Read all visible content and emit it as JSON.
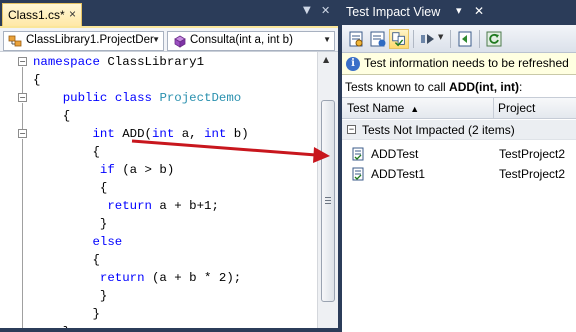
{
  "editor": {
    "tab_label": "Class1.cs*",
    "tab_close_glyph": "×",
    "type_combo": "ClassLibrary1.ProjectDer",
    "member_combo": "Consulta(int a, int b)",
    "code_lines": [
      [
        {
          "t": "kw",
          "s": "namespace"
        },
        {
          "t": "tx",
          "s": " ClassLibrary1"
        }
      ],
      [
        {
          "t": "tx",
          "s": "{"
        }
      ],
      [
        {
          "t": "tx",
          "s": "    "
        },
        {
          "t": "kw",
          "s": "public"
        },
        {
          "t": "tx",
          "s": " "
        },
        {
          "t": "kw",
          "s": "class"
        },
        {
          "t": "tx",
          "s": " "
        },
        {
          "t": "ty",
          "s": "ProjectDemo"
        }
      ],
      [
        {
          "t": "tx",
          "s": "    {"
        }
      ],
      [
        {
          "t": "tx",
          "s": "        "
        },
        {
          "t": "kw",
          "s": "int"
        },
        {
          "t": "tx",
          "s": " ADD("
        },
        {
          "t": "kw",
          "s": "int"
        },
        {
          "t": "tx",
          "s": " a, "
        },
        {
          "t": "kw",
          "s": "int"
        },
        {
          "t": "tx",
          "s": " b)"
        }
      ],
      [
        {
          "t": "tx",
          "s": "        {"
        }
      ],
      [
        {
          "t": "tx",
          "s": "         "
        },
        {
          "t": "kw",
          "s": "if"
        },
        {
          "t": "tx",
          "s": " (a > b)"
        }
      ],
      [
        {
          "t": "tx",
          "s": "         {"
        }
      ],
      [
        {
          "t": "tx",
          "s": "          "
        },
        {
          "t": "kw",
          "s": "return"
        },
        {
          "t": "tx",
          "s": " a + b+1;"
        }
      ],
      [
        {
          "t": "tx",
          "s": "         }"
        }
      ],
      [
        {
          "t": "tx",
          "s": "        "
        },
        {
          "t": "kw",
          "s": "else"
        }
      ],
      [
        {
          "t": "tx",
          "s": "        {"
        }
      ],
      [
        {
          "t": "tx",
          "s": "         "
        },
        {
          "t": "kw",
          "s": "return"
        },
        {
          "t": "tx",
          "s": " (a + b * 2);"
        }
      ],
      [
        {
          "t": "tx",
          "s": "         }"
        }
      ],
      [
        {
          "t": "tx",
          "s": "        }"
        }
      ],
      [
        {
          "t": "tx",
          "s": "    }"
        }
      ]
    ]
  },
  "test_impact": {
    "title": "Test Impact View",
    "info_text": "Test information needs to be refreshed",
    "known_prefix": "Tests known to call ",
    "known_method": "ADD(int, int)",
    "known_suffix": ":",
    "col_test_name": "Test Name",
    "col_project": "Project",
    "group_label": "Tests Not Impacted (2 items)",
    "tests": [
      {
        "name": "ADDTest",
        "project": "TestProject2"
      },
      {
        "name": "ADDTest1",
        "project": "TestProject2"
      }
    ]
  },
  "colors": {
    "keyword": "#0000ff",
    "type": "#2b91af",
    "arrow": "#c8161d",
    "frame": "#2b3c59"
  }
}
